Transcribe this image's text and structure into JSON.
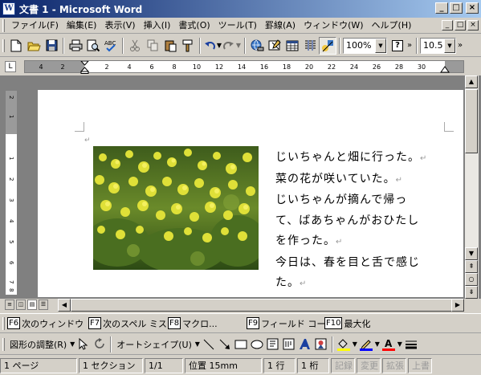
{
  "window": {
    "title": "文書 1 - Microsoft Word",
    "app_icon": "W",
    "minimize": "_",
    "maximize": "□",
    "close": "×"
  },
  "menubar": {
    "items": [
      "ファイル(F)",
      "編集(E)",
      "表示(V)",
      "挿入(I)",
      "書式(O)",
      "ツール(T)",
      "罫線(A)",
      "ウィンドウ(W)",
      "ヘルプ(H)"
    ]
  },
  "toolbar": {
    "zoom": "100%",
    "font_size": "10.5",
    "help_label": "?",
    "more_label": "»"
  },
  "ruler": {
    "corner_symbol": "L",
    "h_ticks": [
      "4",
      "2",
      "2",
      "4",
      "6",
      "8",
      "10",
      "12",
      "14",
      "16",
      "18",
      "20",
      "22",
      "24",
      "26",
      "28",
      "30"
    ],
    "v_ticks": [
      "2",
      "1",
      "1",
      "2",
      "3",
      "4",
      "5",
      "6",
      "7",
      "8"
    ]
  },
  "document": {
    "lines": [
      "じいちゃんと畑に行った。",
      "菜の花が咲いていた。",
      "じいちゃんが摘んで帰っ",
      "て、ばあちゃんがおひたし",
      "を作った。",
      "今日は、春を目と舌で感じ",
      "た。"
    ],
    "line_marks": [
      "↵",
      "↵",
      "",
      "",
      "↵",
      "",
      "↵"
    ],
    "anchor_mark": "↵"
  },
  "function_keys": [
    {
      "key": "F6",
      "label": "次のウィンドウ"
    },
    {
      "key": "F7",
      "label": "次のスペル ミス"
    },
    {
      "key": "F8",
      "label": "マクロ..."
    },
    {
      "key": "F9",
      "label": "フィールド コー..."
    },
    {
      "key": "F10",
      "label": "最大化"
    }
  ],
  "drawing_toolbar": {
    "adjust_shape": "図形の調整(R)",
    "autoshape": "オートシェイプ(U)"
  },
  "statusbar": {
    "page": "1 ページ",
    "section": "1 セクション",
    "page_of": "1/1",
    "position": "位置 15mm",
    "line": "1 行",
    "column": "1 桁",
    "rec": "記録",
    "trk": "変更",
    "ext": "拡張",
    "ovr": "上書"
  },
  "colors": {
    "title_start": "#0a246a",
    "title_end": "#a6caf0",
    "chrome": "#d4d0c8",
    "workspace": "#808080",
    "highlight_yellow": "#ffff00",
    "font_red": "#ff0000",
    "line_blue": "#0000ff"
  }
}
